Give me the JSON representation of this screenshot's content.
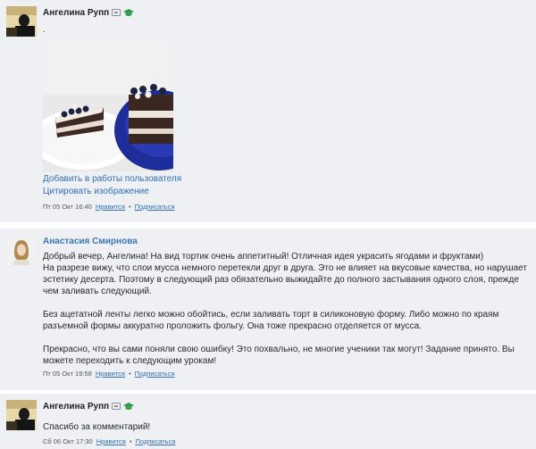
{
  "post1": {
    "author": "Ангелина Рупп",
    "text": ".",
    "links": [
      "Добавить в работы пользователя",
      "Цитировать изображение"
    ],
    "date": "Пт 05 Окт 16:40",
    "like_label": "Нравится",
    "subscribe_label": "Подписаться",
    "separator": "•"
  },
  "post2": {
    "author": "Анастасия Смирнова",
    "paragraphs": [
      "Добрый вечер, Ангелина! На вид тортик очень аппетитный! Отличная идея украсить ягодами и фруктами)",
      "На разрезе вижу, что слои мусса немного перетекли друг в друга. Это не влияет на вкусовые качества, но нарушает эстетику десерта. Поэтому в следующий раз обязательно выжидайте до полного застывания одного слоя, прежде чем заливать следующий.",
      "Без ацетатной ленты легко можно обойтись, если заливать торт в силиконовую форму. Либо можно по краям разъемной формы аккуратно проложить фольгу. Она тоже прекрасно отделяется от мусса.",
      "Прекрасно, что вы сами поняли свою ошибку! Это похвально, не многие ученики так могут! Задание принято. Вы можете переходить к следующим урокам!"
    ],
    "date": "Пт 05 Окт 19:58",
    "like_label": "Нравится",
    "subscribe_label": "Подписаться",
    "separator": "•"
  },
  "post3": {
    "author": "Ангелина Рупп",
    "text": "Спасибо за комментарий!",
    "date": "Сб 06 Окт 17:30",
    "like_label": "Нравится",
    "subscribe_label": "Подписаться",
    "separator": "•"
  },
  "colors": {
    "link": "#2f6fb5",
    "tutor_name": "#3a76b5",
    "panel": "#eef0f4",
    "cap_icon": "#2e9c4a"
  }
}
